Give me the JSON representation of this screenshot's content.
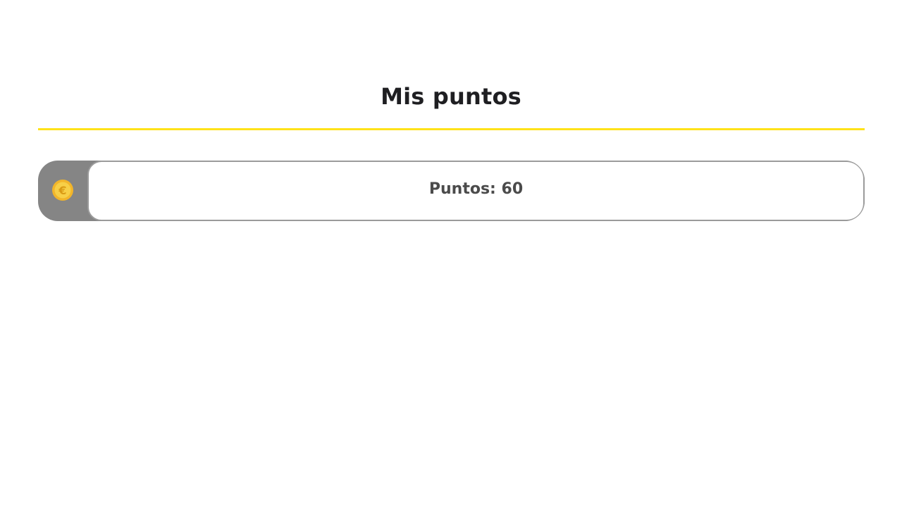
{
  "header": {
    "title": "Mis puntos"
  },
  "points": {
    "label": "Puntos: 60",
    "icon": "coin-euro-icon"
  },
  "colors": {
    "accent": "#ffe21a",
    "card_side": "#858585",
    "card_border": "#9b9b9b",
    "coin": "#f5c63b",
    "text": "#1f1f22"
  }
}
